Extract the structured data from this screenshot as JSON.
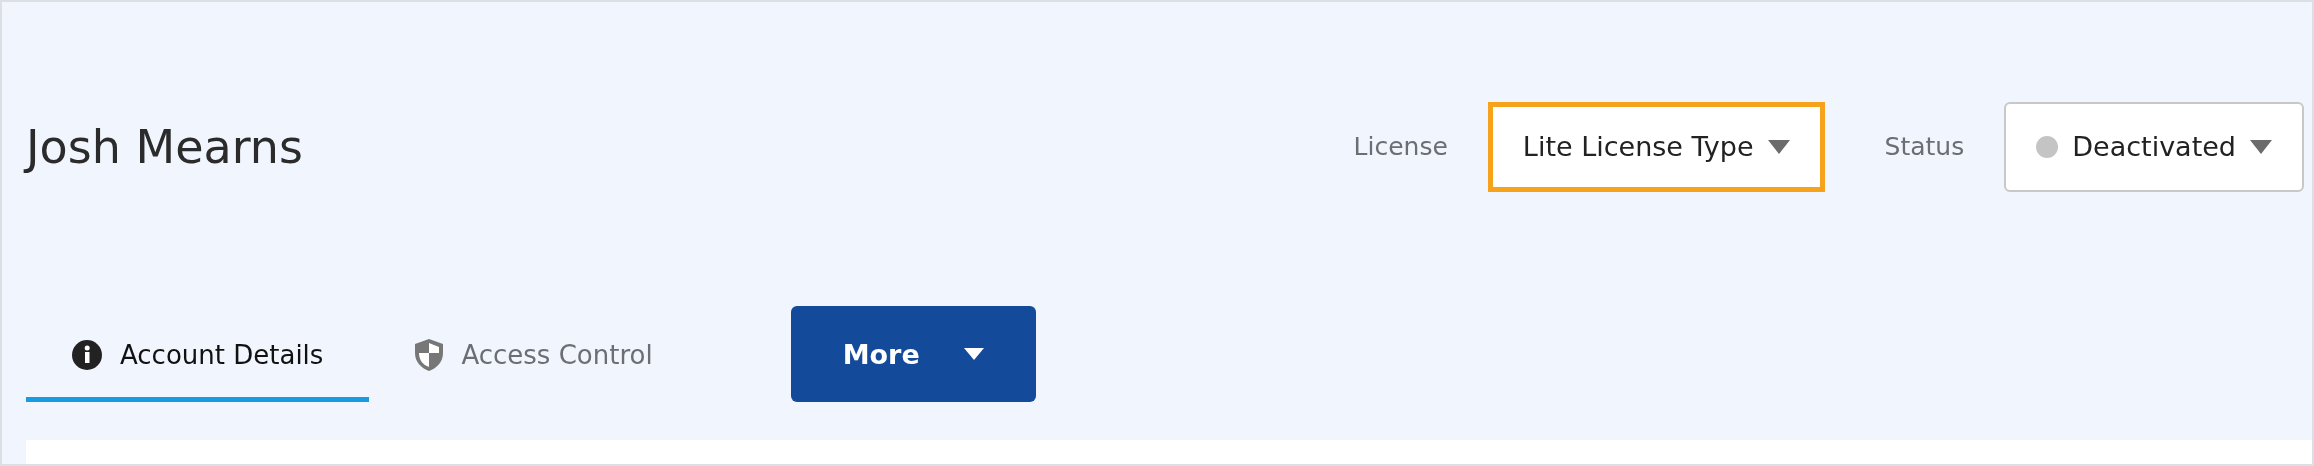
{
  "title": "Josh Mearns",
  "fields": [
    {
      "label": "License",
      "value": "Lite License Type",
      "kind": "plain",
      "highlighted": true
    },
    {
      "label": "Status",
      "value": "Deactivated",
      "kind": "status",
      "highlighted": false
    }
  ],
  "tabs": [
    {
      "label": "Account Details",
      "selected": true
    },
    {
      "label": "Access Control",
      "selected": false
    }
  ],
  "more_button": "More"
}
